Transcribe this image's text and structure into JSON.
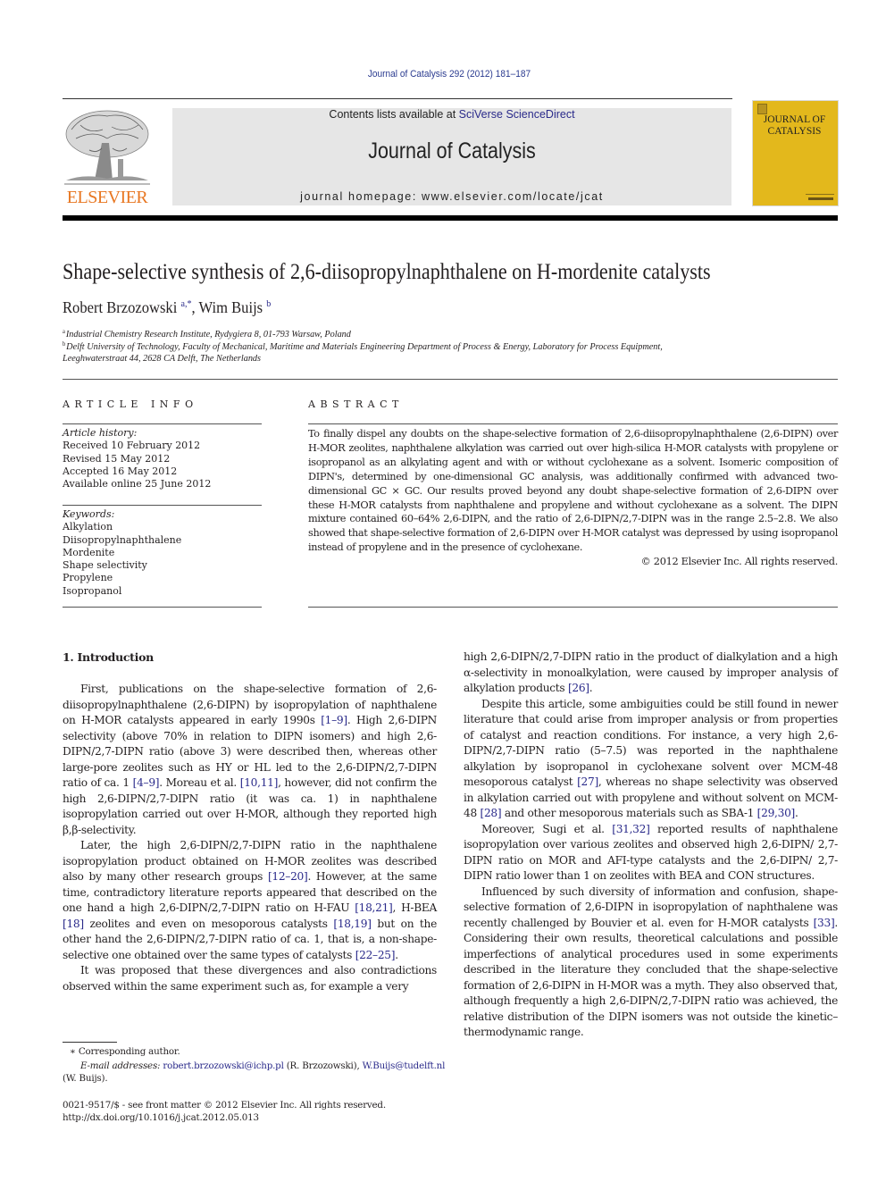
{
  "header": {
    "journal_reference": "Journal of Catalysis 292 (2012) 181–187",
    "contents_prefix": "Contents lists available at ",
    "contents_link": "SciVerse ScienceDirect",
    "journal_name": "Journal of Catalysis",
    "homepage_line": "journal homepage: www.elsevier.com/locate/jcat",
    "publisher_logo_text": "ELSEVIER",
    "cover_title_line1": "JOURNAL OF",
    "cover_title_line2": "CATALYSIS",
    "colors": {
      "link": "#2a2a8a",
      "elsevier_orange": "#e87722",
      "cover_yellow": "#e3b81c",
      "masthead_gray": "#e6e6e6"
    }
  },
  "article": {
    "title": "Shape-selective synthesis of 2,6-diisopropylnaphthalene on H-mordenite catalysts",
    "authors": [
      {
        "name": "Robert Brzozowski",
        "marks": "a,*"
      },
      {
        "name": "Wim Buijs",
        "marks": "b"
      }
    ],
    "author_separator": ", ",
    "affiliations": [
      {
        "mark": "a",
        "text": "Industrial Chemistry Research Institute, Rydygiera 8, 01-793 Warsaw, Poland"
      },
      {
        "mark": "b",
        "text": "Delft University of Technology, Faculty of Mechanical, Maritime and Materials Engineering Department of Process & Energy, Laboratory for Process Equipment,",
        "continuation": "Leeghwaterstraat 44, 2628 CA Delft, The Netherlands"
      }
    ]
  },
  "article_info": {
    "heading": "ARTICLE INFO",
    "history_label": "Article history:",
    "history": [
      "Received 10 February 2012",
      "Revised 15 May 2012",
      "Accepted 16 May 2012",
      "Available online 25 June 2012"
    ],
    "keywords_label": "Keywords:",
    "keywords": [
      "Alkylation",
      "Diisopropylnaphthalene",
      "Mordenite",
      "Shape selectivity",
      "Propylene",
      "Isopropanol"
    ]
  },
  "abstract": {
    "heading": "ABSTRACT",
    "text": "To finally dispel any doubts on the shape-selective formation of 2,6-diisopropylnaphthalene (2,6-DIPN) over H-MOR zeolites, naphthalene alkylation was carried out over high-silica H-MOR catalysts with propylene or isopropanol as an alkylating agent and with or without cyclohexane as a solvent. Isomeric composition of DIPN's, determined by one-dimensional GC analysis, was additionally confirmed with advanced two-dimensional GC × GC. Our results proved beyond any doubt shape-selective formation of 2,6-DIPN over these H-MOR catalysts from naphthalene and propylene and without cyclohexane as a solvent. The DIPN mixture contained 60–64% 2,6-DIPN, and the ratio of 2,6-DIPN/2,7-DIPN was in the range 2.5–2.8. We also showed that shape-selective formation of 2,6-DIPN over H-MOR catalyst was depressed by using isopropanol instead of propylene and in the presence of cyclohexane.",
    "copyright": "© 2012 Elsevier Inc. All rights reserved."
  },
  "body": {
    "section_heading": "1. Introduction",
    "left_paragraphs": [
      [
        {
          "t": "First, publications on the shape-selective formation of 2,6-diisopropylnaphthalene (2,6-DIPN) by isopropylation of naphthalene on H-MOR catalysts appeared in early 1990s "
        },
        {
          "ref": "[1–9]"
        },
        {
          "t": ". High 2,6-DIPN selectivity (above 70% in relation to DIPN isomers) and high 2,6-DIPN/2,7-DIPN ratio (above 3) were described then, whereas other large-pore zeolites such as HY or HL led to the 2,6-DIPN/2,7-DIPN ratio of ca. 1 "
        },
        {
          "ref": "[4–9]"
        },
        {
          "t": ". Moreau et al. "
        },
        {
          "ref": "[10,11]"
        },
        {
          "t": ", however, did not confirm the high 2,6-DIPN/2,7-DIPN ratio (it was ca. 1) in naphthalene isopropylation carried out over H-MOR, although they reported high β,β-selectivity."
        }
      ],
      [
        {
          "t": "Later, the high 2,6-DIPN/2,7-DIPN ratio in the naphthalene isopropylation product obtained on H-MOR zeolites was described also by many other research groups "
        },
        {
          "ref": "[12–20]"
        },
        {
          "t": ". However, at the same time, contradictory literature reports appeared that described on the one hand a high 2,6-DIPN/2,7-DIPN ratio on H-FAU "
        },
        {
          "ref": "[18,21]"
        },
        {
          "t": ", H-BEA "
        },
        {
          "ref": "[18]"
        },
        {
          "t": " zeolites and even on mesoporous catalysts "
        },
        {
          "ref": "[18,19]"
        },
        {
          "t": " but on the other hand the 2,6-DIPN/2,7-DIPN ratio of ca. 1, that is, a non-shape-selective one obtained over the same types of catalysts "
        },
        {
          "ref": "[22–25]"
        },
        {
          "t": "."
        }
      ],
      [
        {
          "t": "It was proposed that these divergences and also contradictions observed within the same experiment such as, for example a very"
        }
      ]
    ],
    "right_paragraphs": [
      [
        {
          "t": "high 2,6-DIPN/2,7-DIPN ratio in the product of dialkylation and a high α-selectivity in monoalkylation, were caused by improper analysis of alkylation products "
        },
        {
          "ref": "[26]"
        },
        {
          "t": "."
        }
      ],
      [
        {
          "t": "Despite this article, some ambiguities could be still found in newer literature that could arise from improper analysis or from properties of catalyst and reaction conditions. For instance, a very high 2,6-DIPN/2,7-DIPN ratio (5–7.5) was reported in the naphthalene alkylation by isopropanol in cyclohexane solvent over MCM-48 mesoporous catalyst "
        },
        {
          "ref": "[27]"
        },
        {
          "t": ", whereas no shape selectivity was observed in alkylation carried out with propylene and without solvent on MCM-48 "
        },
        {
          "ref": "[28]"
        },
        {
          "t": " and other mesoporous materials such as SBA-1 "
        },
        {
          "ref": "[29,30]"
        },
        {
          "t": "."
        }
      ],
      [
        {
          "t": "Moreover, Sugi et al. "
        },
        {
          "ref": "[31,32]"
        },
        {
          "t": " reported results of naphthalene isopropylation over various zeolites and observed high 2,6-DIPN/ 2,7-DIPN ratio on MOR and AFI-type catalysts and the 2,6-DIPN/ 2,7-DIPN ratio lower than 1 on zeolites with BEA and CON structures."
        }
      ],
      [
        {
          "t": "Influenced by such diversity of information and confusion, shape-selective formation of 2,6-DIPN in isopropylation of naphthalene was recently challenged by Bouvier et al. even for H-MOR catalysts "
        },
        {
          "ref": "[33]"
        },
        {
          "t": ". Considering their own results, theoretical calculations and possible imperfections of analytical procedures used in some experiments described in the literature they concluded that the shape-selective formation of 2,6-DIPN in H-MOR was a myth. They also observed that, although frequently a high 2,6-DIPN/2,7-DIPN ratio was achieved, the relative distribution of the DIPN isomers was not outside the kinetic–thermodynamic range."
        }
      ]
    ]
  },
  "footnotes": {
    "corresponding": "∗  Corresponding author.",
    "email_label": "E-mail addresses:",
    "email_1": "robert.brzozowski@ichp.pl",
    "email_1_name": " (R. Brzozowski), ",
    "email_2": "W.Buijs@tudelft.nl",
    "email_2_name": "(W. Buijs).",
    "issn_line": "0021-9517/$ - see front matter © 2012 Elsevier Inc. All rights reserved.",
    "doi": "http://dx.doi.org/10.1016/j.jcat.2012.05.013"
  }
}
